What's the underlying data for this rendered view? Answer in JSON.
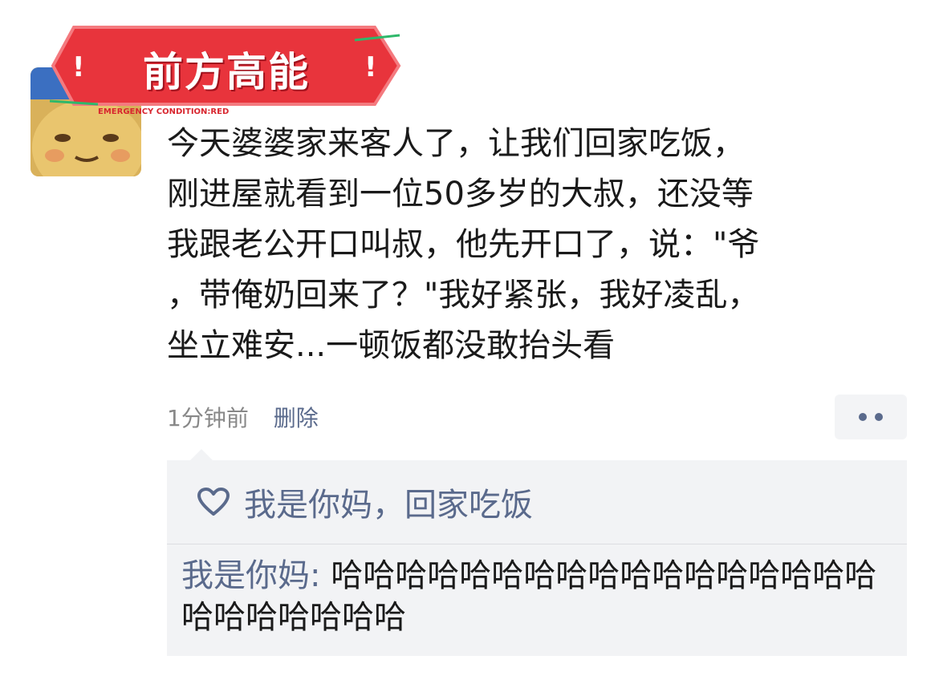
{
  "banner": {
    "title": "前方高能",
    "subtitle": "EMERGENCY CONDITION:RED",
    "mark_left": "!",
    "mark_right": "!"
  },
  "post": {
    "lines": [
      "今天婆婆家来客人了，让我们回家吃饭，",
      "刚进屋就看到一位50多岁的大叔，还没等",
      "我跟老公开口叫叔，他先开口了，说：\"爷",
      "，带俺奶回来了？\"我好紧张，我好凌乱，",
      "坐立难安...一顿饭都没敢抬头看"
    ],
    "time": "1分钟前",
    "delete_label": "删除"
  },
  "likes": {
    "icon": "heart-outline-icon",
    "text": "我是你妈，回家吃饭"
  },
  "comment": {
    "author": "我是你妈:",
    "text": " 哈哈哈哈哈哈哈哈哈哈哈哈哈哈哈哈哈哈哈哈哈哈哈哈"
  },
  "colors": {
    "link": "#5a6a8c",
    "banner_red": "#e8343c",
    "panel_bg": "#f2f3f5"
  }
}
